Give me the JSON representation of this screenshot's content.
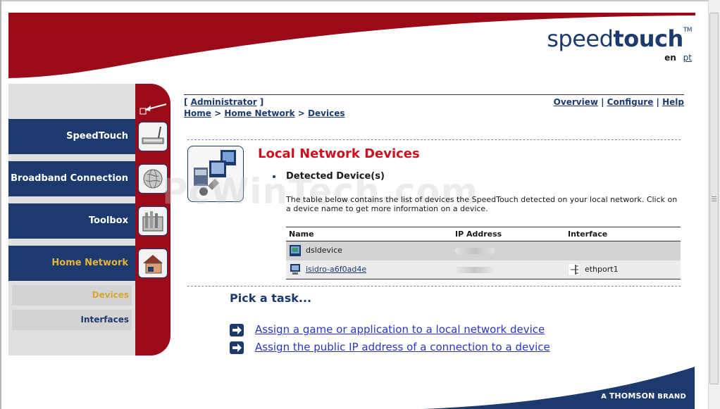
{
  "header": {
    "logo_light": "speed",
    "logo_bold": "touch",
    "logo_tm": "TM",
    "lang_active": "en",
    "lang_other": "pt"
  },
  "nav": {
    "items": [
      {
        "label": "SpeedTouch",
        "icon": "router-icon"
      },
      {
        "label": "Broadband Connection",
        "icon": "globe-icon"
      },
      {
        "label": "Toolbox",
        "icon": "toolbox-icon"
      },
      {
        "label": "Home Network",
        "icon": "house-icon"
      }
    ],
    "sub_items": [
      {
        "label": "Devices"
      },
      {
        "label": "Interfaces"
      }
    ]
  },
  "top": {
    "admin_open": "[ ",
    "admin_label": "Administrator",
    "admin_close": " ]",
    "breadcrumb": [
      "Home",
      "Home Network",
      "Devices"
    ],
    "sep": " > ",
    "links": [
      "Overview",
      "Configure",
      "Help"
    ],
    "link_sep": " | "
  },
  "watermark": "PcWinTech.com",
  "main": {
    "title": "Local Network Devices",
    "section": "Detected Device(s)",
    "description": "The table below contains the list of devices the SpeedTouch detected on your local network. Click on a device name to get more information on a device."
  },
  "table": {
    "columns": [
      "Name",
      "IP Address",
      "Interface"
    ],
    "rows": [
      {
        "name": "dsldevice",
        "ip": "",
        "interface": ""
      },
      {
        "name": "isidro-a6f0ad4e",
        "ip": "",
        "interface": "ethport1"
      }
    ]
  },
  "tasks": {
    "heading": "Pick a task...",
    "items": [
      "Assign a game or application to a local network device",
      "Assign the public IP address of a connection to a device"
    ]
  },
  "footer": {
    "brand_prefix": "A ",
    "brand_name": "THOMSON",
    "brand_suffix": " BRAND"
  },
  "colors": {
    "brand_red": "#9b0a18",
    "nav_blue": "#1c3a6e",
    "title_red": "#cc1020",
    "current_gold": "#e6b43a",
    "link_blue": "#2a34c9"
  }
}
